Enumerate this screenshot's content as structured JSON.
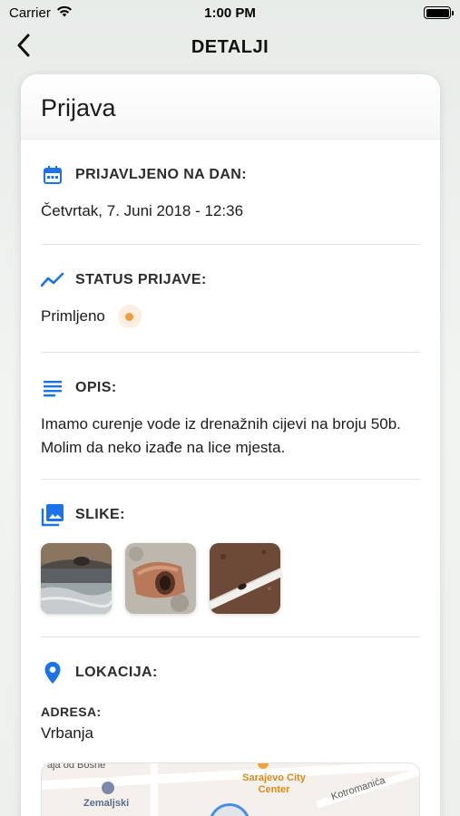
{
  "status_bar": {
    "carrier": "Carrier",
    "time": "1:00 PM"
  },
  "nav": {
    "title": "DETALJI"
  },
  "card": {
    "title": "Prijava",
    "reported": {
      "label": "PRIJAVLJENO NA DAN:",
      "value": "Četvrtak, 7. Juni 2018 - 12:36"
    },
    "status": {
      "label": "STATUS PRIJAVE:",
      "value": "Primljeno",
      "color": "#f39a3a"
    },
    "description": {
      "label": "OPIS:",
      "value": "Imamo curenje vode iz drenažnih cijevi na broju 50b. Molim da neko izađe na lice mjesta."
    },
    "photos": {
      "label": "SLIKE:",
      "items": [
        "photo-1",
        "photo-2",
        "photo-3"
      ]
    },
    "location": {
      "label": "LOKACIJA:",
      "address_label": "ADRESA:",
      "address": "Vrbanja",
      "map_labels": {
        "street1": "aja od Bosne",
        "poi": "Sarajevo City Center",
        "street2": "Kotromanića",
        "museum": "Zemaljski"
      }
    }
  },
  "colors": {
    "accent": "#1a73e8",
    "status": "#f39a3a"
  }
}
